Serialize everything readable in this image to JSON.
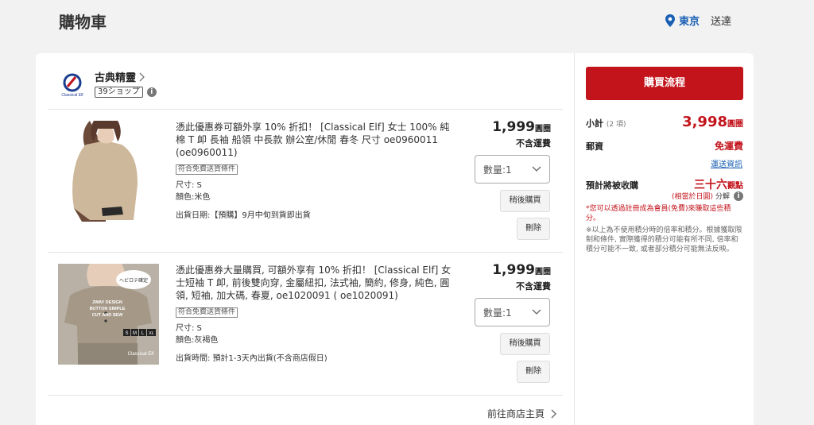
{
  "header": {
    "title": "購物車",
    "location_city": "東京",
    "location_suffix": "送達"
  },
  "shop": {
    "name": "古典精靈",
    "badge": "39ショップ",
    "info_icon": "i",
    "logo_text": "Classical Elf"
  },
  "items": [
    {
      "title": "憑此優惠券可額外享 10% 折扣！ [Classical Elf] 女士 100% 純棉 T 卹 長袖 船領 中長款 辦公室/休閒 春冬 尺寸 oe0960011 (oe0960011)",
      "free_ship_tag": "符合免費送貨條件",
      "size": "尺寸: S",
      "color": "顏色:米色",
      "ship_date": "出貨日期:【預購】9月中旬到貨即出貨",
      "price": "1,999",
      "price_unit": "圓圈",
      "shipping": "不含運費",
      "quantity": "數量:1",
      "save_later": "稍後購買",
      "delete": "刪除"
    },
    {
      "title": "憑此優惠券大量購買, 可額外享有 10% 折扣！ [Classical Elf] 女士短袖 T 卹, 前後雙向穿, 金屬紐扣, 法式袖, 簡約, 修身, 純色, 圓領, 短袖, 加大碼, 春夏, oe1020091 ( oe1020091)",
      "free_ship_tag": "符合免費送貨條件",
      "size": "尺寸: S",
      "color": "顏色:灰褐色",
      "ship_date": "出貨時間: 預計1-3天內出貨(不含商店假日)",
      "price": "1,999",
      "price_unit": "圓圈",
      "shipping": "不含運費",
      "quantity": "數量:1",
      "save_later": "稍後購買",
      "delete": "刪除",
      "img_badge": "ヘビロテ確定",
      "img_caption": "2WAY DESIGN BUTTON SIMPLE CUT AND SEW",
      "img_sizes": [
        "S",
        "M",
        "L",
        "XL"
      ],
      "img_brand": "Classical Elf"
    }
  ],
  "goto_store": "前往商店主頁",
  "summary": {
    "checkout": "購買流程",
    "subtotal_label": "小計",
    "subtotal_count": "(2 項)",
    "subtotal_value": "3,998",
    "subtotal_unit": "圓圈",
    "shipping_label": "郵資",
    "shipping_value": "免運費",
    "shipping_info": "運送資訊",
    "points_label": "預計將被收購",
    "points_value": "三十六",
    "points_unit": "觀點",
    "points_equiv": "(相當於日圓)",
    "points_equiv_suffix": "分解",
    "note_red": "*您可以透過註冊成為會員(免費)來賺取這些積分。",
    "note_gray": "※以上為不使用積分時的倍率和積分。根據獲取限制和條件, 實際獲得的積分可能有所不同, 倍率和積分可能不一致, 或者部分積分可能無法反映。"
  },
  "colors": {
    "accent_red": "#c3141c",
    "link_blue": "#1a5fb4"
  }
}
